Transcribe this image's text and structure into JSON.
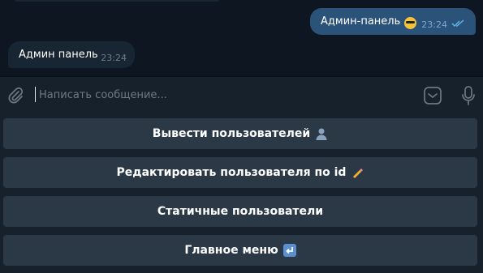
{
  "messages": {
    "outgoing": {
      "text": "Админ-панель",
      "emoji": "sunglasses-emoji",
      "time": "23:24",
      "status": "read"
    },
    "incoming": {
      "text": "Админ панель",
      "time": "23:24"
    }
  },
  "composer": {
    "placeholder": "Написать сообщение..."
  },
  "keyboard": {
    "buttons": [
      {
        "label": "Вывести пользователей",
        "icon": "bust-in-silhouette-emoji"
      },
      {
        "label": "Редактировать пользователя по id",
        "icon": "pencil-emoji"
      },
      {
        "label": "Статичные пользователи",
        "icon": ""
      },
      {
        "label": "Главное меню",
        "icon": "return-arrow-emoji"
      }
    ]
  },
  "colors": {
    "chat_bg": "#0e1621",
    "outgoing_bubble": "#2b5278",
    "incoming_bubble": "#182533",
    "panel_bg": "#17212b",
    "keyboard_button": "#2b3947",
    "read_ticks": "#5fb5f0"
  }
}
